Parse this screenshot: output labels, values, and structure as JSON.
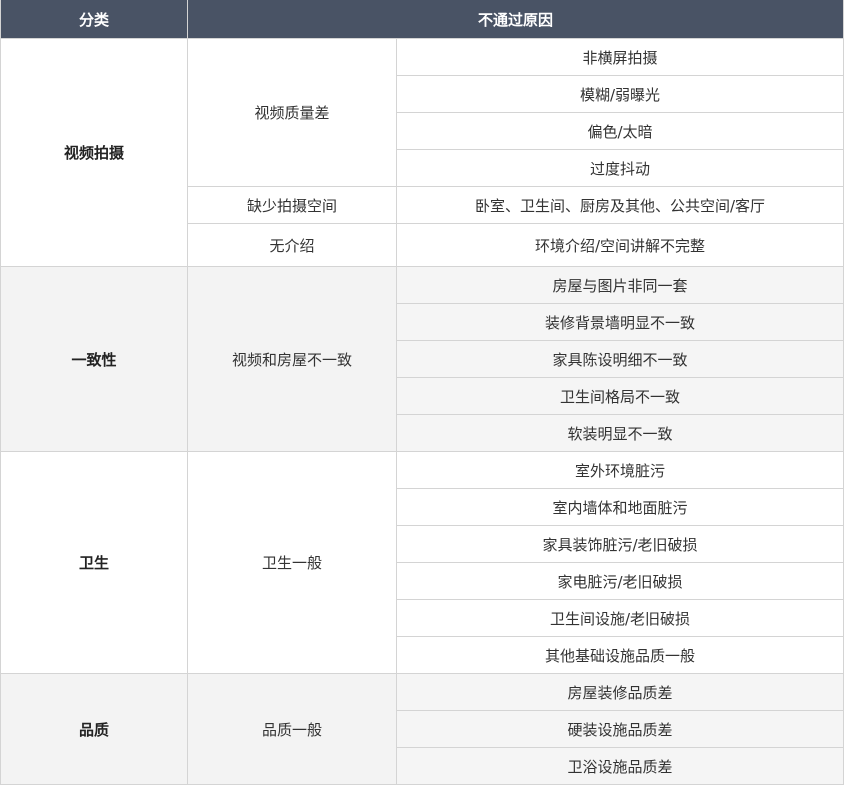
{
  "header": {
    "col_category": "分类",
    "col_reason": "不通过原因"
  },
  "groups": [
    {
      "category": "视频拍摄",
      "subs": [
        {
          "name": "视频质量差",
          "reasons": [
            "非横屏拍摄",
            "模糊/弱曝光",
            "偏色/太暗",
            "过度抖动"
          ]
        },
        {
          "name": "缺少拍摄空间",
          "reasons": [
            "卧室、卫生间、厨房及其他、公共空间/客厅"
          ]
        },
        {
          "name": "无介绍",
          "reasons": [
            "环境介绍/空间讲解不完整"
          ]
        }
      ]
    },
    {
      "category": "一致性",
      "subs": [
        {
          "name": "视频和房屋不一致",
          "reasons": [
            "房屋与图片非同一套",
            "装修背景墙明显不一致",
            "家具陈设明细不一致",
            "卫生间格局不一致",
            "软装明显不一致"
          ]
        }
      ]
    },
    {
      "category": "卫生",
      "subs": [
        {
          "name": "卫生一般",
          "reasons": [
            "室外环境脏污",
            "室内墙体和地面脏污",
            "家具装饰脏污/老旧破损",
            "家电脏污/老旧破损",
            "卫生间设施/老旧破损",
            "其他基础设施品质一般"
          ]
        }
      ]
    },
    {
      "category": "品质",
      "subs": [
        {
          "name": "品质一般",
          "reasons": [
            "房屋装修品质差",
            "硬装设施品质差",
            "卫浴设施品质差"
          ]
        }
      ]
    }
  ]
}
